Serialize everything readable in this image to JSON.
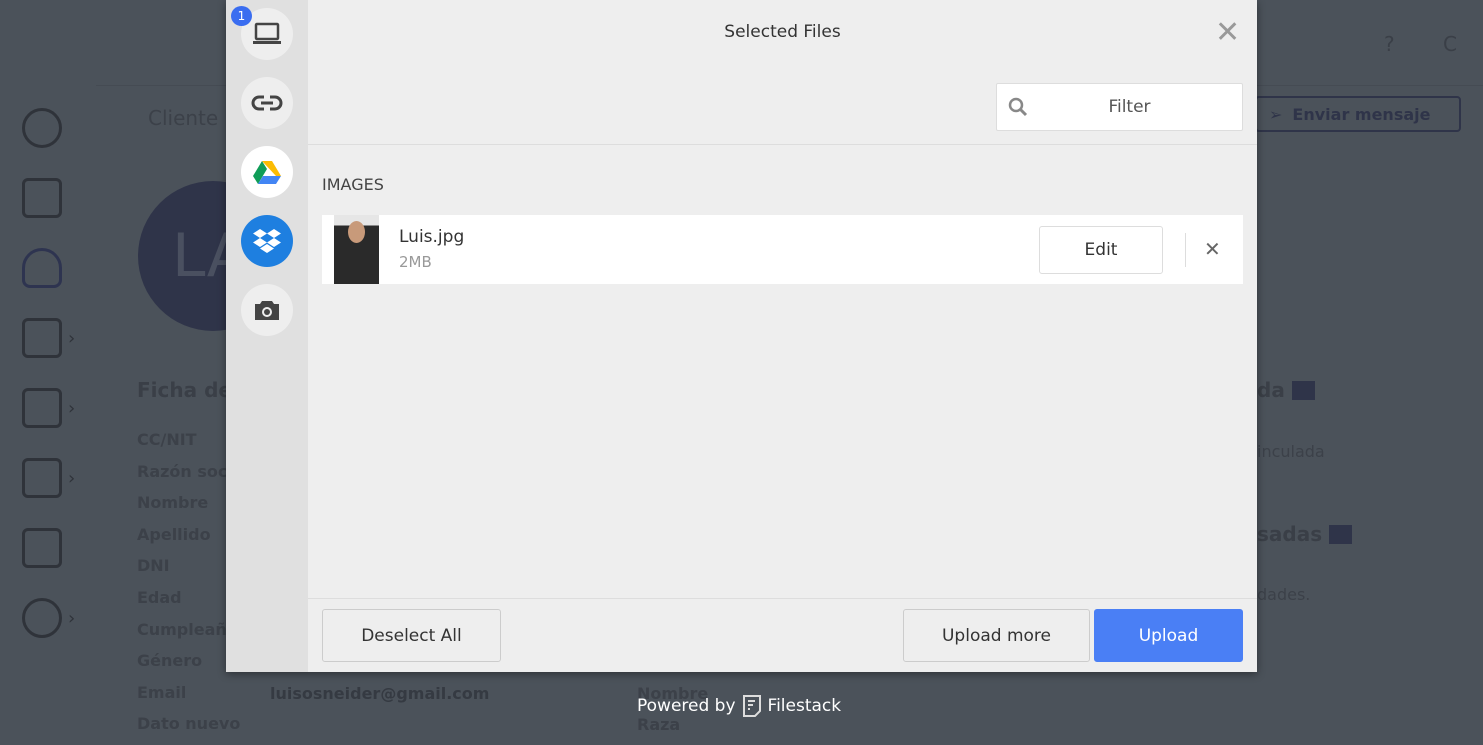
{
  "background": {
    "tab": "Cliente",
    "avatar_initials": "LA",
    "section_title": "Ficha de",
    "fields": [
      "CC/NIT",
      "Razón soc",
      "Nombre",
      "Apellido",
      "DNI",
      "Edad",
      "Cumpleañ",
      "Género",
      "Email",
      "Dato nuevo"
    ],
    "email_value": "luisosneider@gmail.com",
    "right_labels": [
      "Nombre",
      "Raza"
    ],
    "send_button": "Enviar mensaje",
    "help": "?",
    "user_initial": "C",
    "linked_title": "da",
    "linked_text": "inculada",
    "used_title": "sadas",
    "used_text": "dades."
  },
  "modal": {
    "title": "Selected Files",
    "filter_placeholder": "Filter",
    "badge_count": "1",
    "sources": [
      "local-device",
      "link",
      "google-drive",
      "dropbox",
      "camera"
    ],
    "section": "IMAGES",
    "files": [
      {
        "name": "Luis.jpg",
        "size": "2MB",
        "edit": "Edit"
      }
    ],
    "deselect_all": "Deselect All",
    "upload_more": "Upload more",
    "upload": "Upload"
  },
  "footer": {
    "powered_by": "Powered by",
    "brand": "Filestack"
  },
  "colors": {
    "accent": "#4a7ff5",
    "dropbox": "#1e7fe0",
    "overlay": "#4b525a"
  }
}
